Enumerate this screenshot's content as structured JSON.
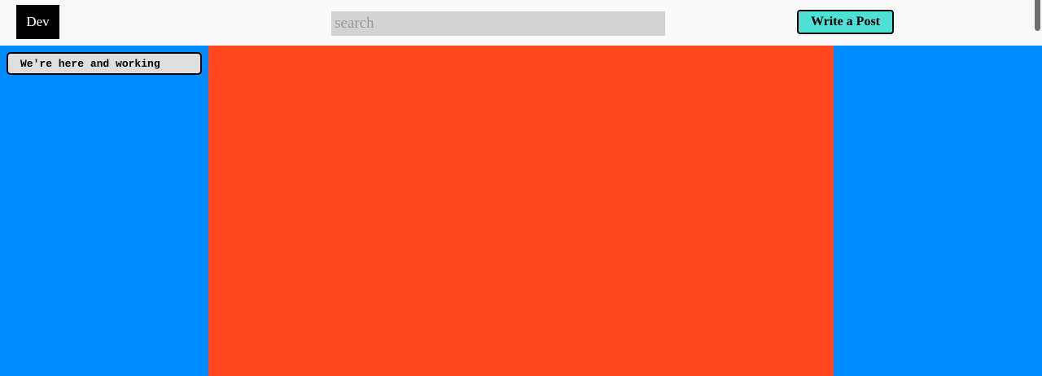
{
  "header": {
    "logo_text": "Dev",
    "search_placeholder": "search",
    "write_post_label": "Write a Post"
  },
  "left_panel": {
    "status_button_label": "We're here and working"
  },
  "colors": {
    "header_bg": "#f9f9f9",
    "logo_bg": "#000000",
    "search_bg": "#d3d3d3",
    "write_post_bg": "#4ee0d4",
    "side_panels_bg": "#008cff",
    "main_panel_bg": "#ff471c",
    "status_button_bg": "#dedede"
  }
}
